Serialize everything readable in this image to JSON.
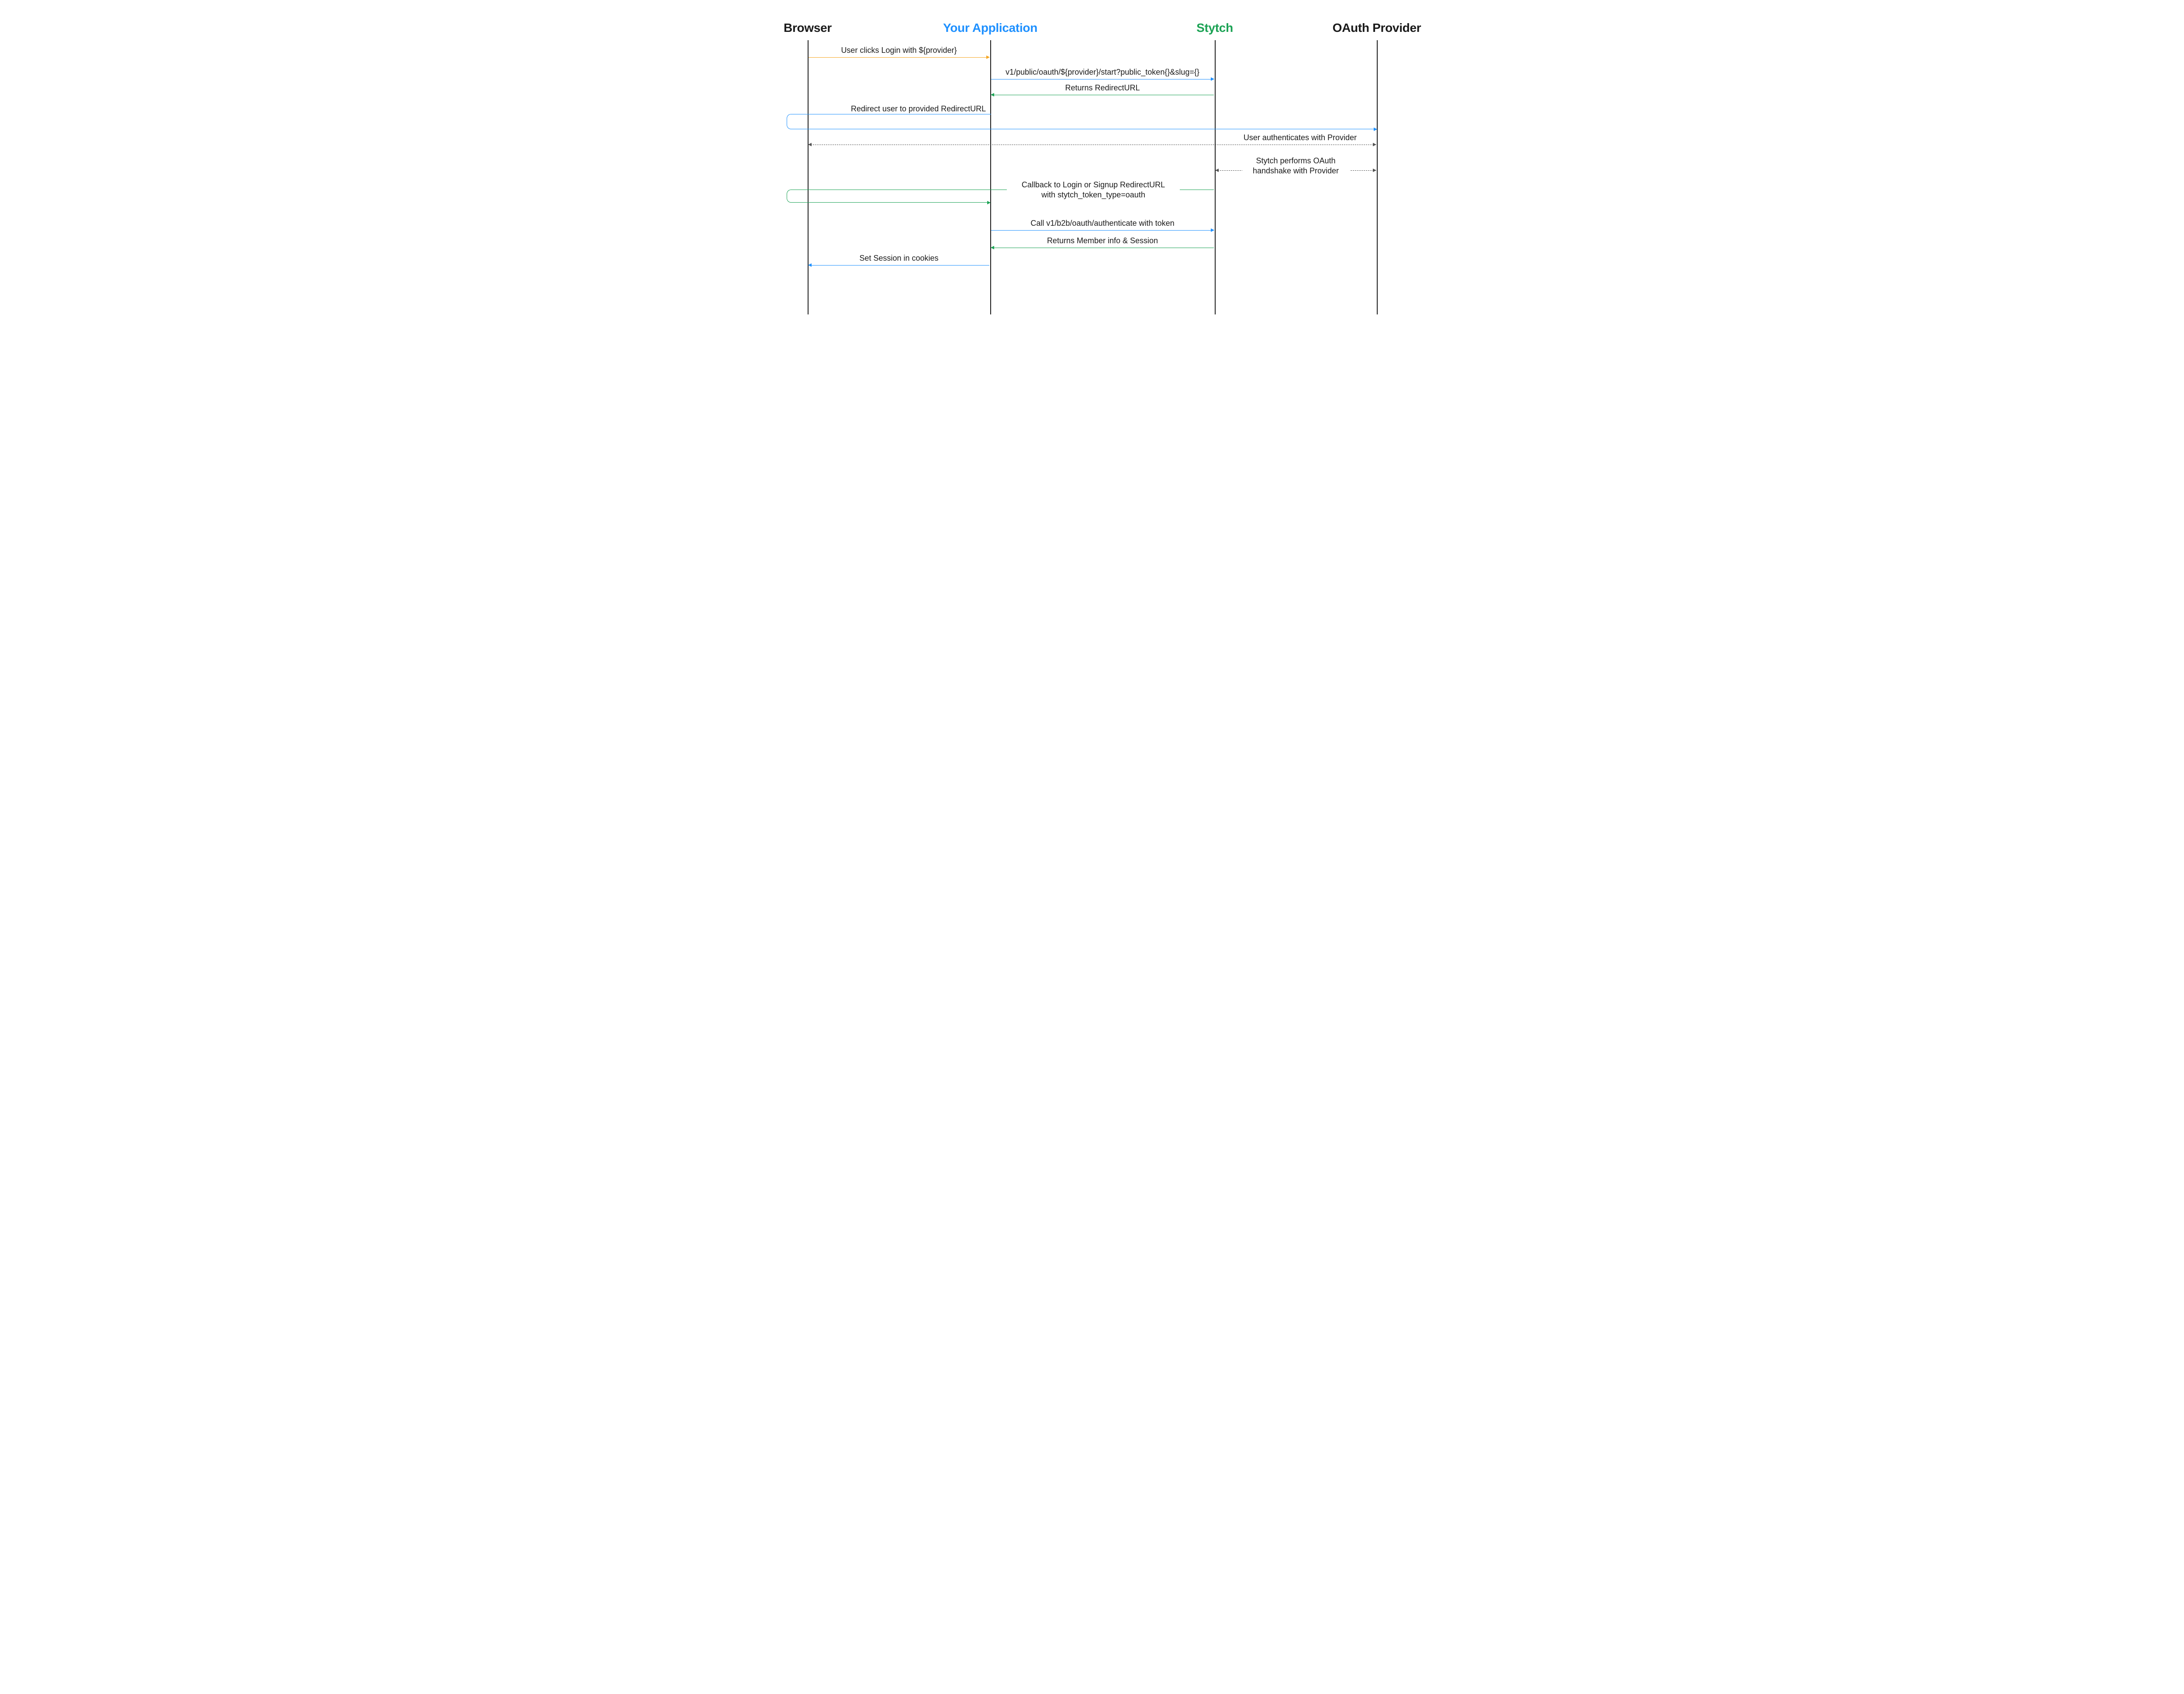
{
  "actors": {
    "browser": {
      "label": "Browser",
      "color": "#1a1a1a"
    },
    "app": {
      "label": "Your Application",
      "color": "#1e90ff"
    },
    "stytch": {
      "label": "Stytch",
      "color": "#1ba254"
    },
    "provider": {
      "label": "OAuth Provider",
      "color": "#1a1a1a"
    }
  },
  "messages": {
    "m1": "User clicks Login with ${provider}",
    "m2": "v1/public/oauth/${provider}/start?public_token{}&slug={}",
    "m3": "Returns RedirectURL",
    "m4": "Redirect user to provided RedirectURL",
    "m5": "User authenticates with Provider",
    "m6": "Stytch performs OAuth\nhandshake with Provider",
    "m7": "Callback to Login or Signup RedirectURL\nwith stytch_token_type=oauth",
    "m8": "Call v1/b2b/oauth/authenticate with token",
    "m9": "Returns Member info & Session",
    "m10": "Set Session in cookies"
  }
}
